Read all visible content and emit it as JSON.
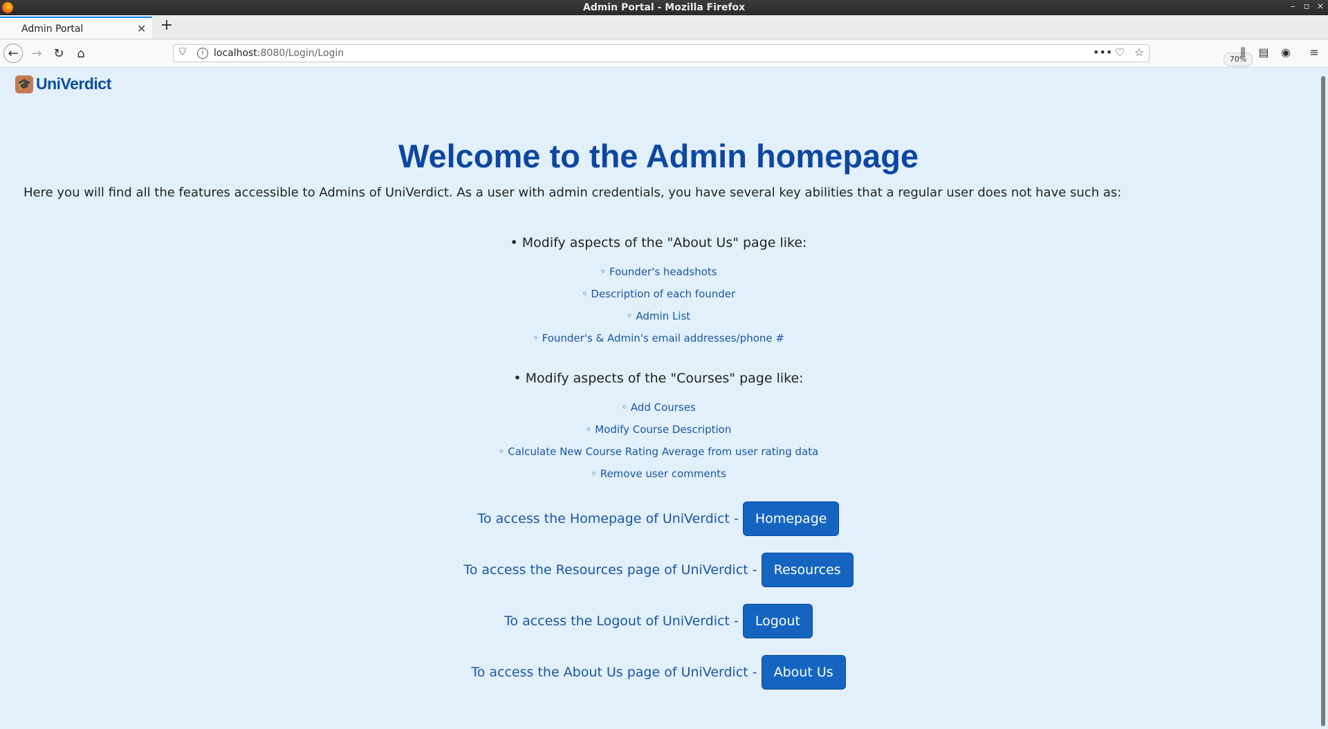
{
  "window": {
    "title": "Admin Portal - Mozilla Firefox"
  },
  "tabs": [
    {
      "label": "Admin Portal",
      "active": true
    }
  ],
  "toolbar": {
    "url_host": "localhost",
    "url_path": ":8080/Login/Login",
    "zoom": "70%"
  },
  "page": {
    "brand": "UniVerdict",
    "heading": "Welcome to the Admin homepage",
    "intro": "Here you will find all the features accessible to Admins of UniVerdict. As a user with admin credentials, you have several key abilities that a regular user does not have such as:",
    "sections": [
      {
        "title": "• Modify aspects of the \"About Us\" page like:",
        "items": [
          "◦ Founder's headshots",
          "◦ Description of each founder",
          "◦ Admin List",
          "◦ Founder's & Admin's email addresses/phone #"
        ]
      },
      {
        "title": "• Modify aspects of the \"Courses\" page like:",
        "items": [
          "◦ Add Courses",
          "◦ Modify Course Description",
          "◦ Calculate New Course Rating Average from user rating data",
          "◦ Remove user comments"
        ]
      }
    ],
    "access": [
      {
        "label": "To access the Homepage of UniVerdict -",
        "button": "Homepage"
      },
      {
        "label": "To access the Resources page of UniVerdict -",
        "button": "Resources"
      },
      {
        "label": "To access the Logout of UniVerdict -",
        "button": "Logout"
      },
      {
        "label": "To access the About Us page of UniVerdict -",
        "button": "About Us"
      }
    ]
  },
  "colors": {
    "page_background": "#e2f0fb",
    "heading": "#0d47a1",
    "button": "#1565c0",
    "link_text": "#1a56a0"
  }
}
